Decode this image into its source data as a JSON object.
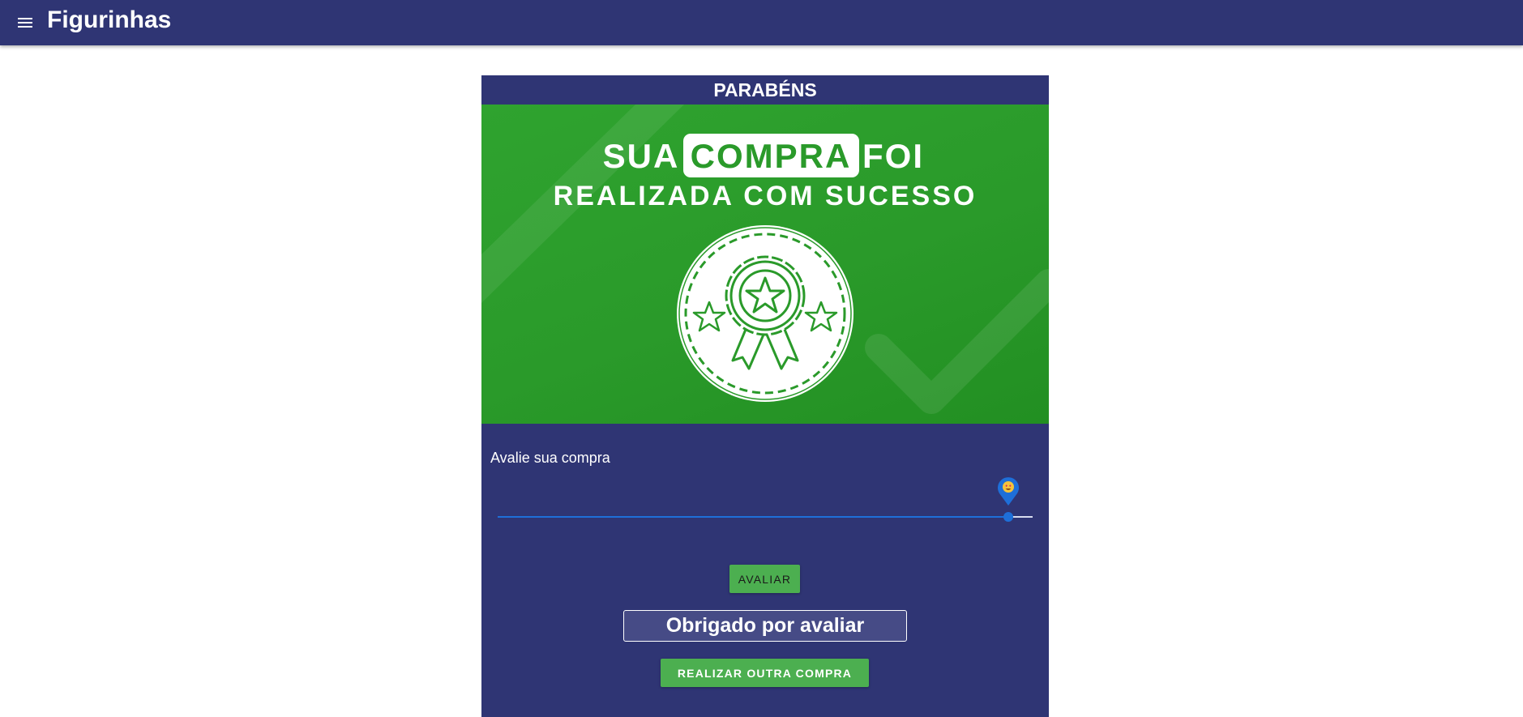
{
  "app": {
    "title": "Figurinhas",
    "menu_icon": "menu-icon"
  },
  "colors": {
    "primary": "#2f3574",
    "success_green": "#4caf50",
    "banner_green": "#2a9a2a",
    "slider_blue": "#1e6fd9"
  },
  "card": {
    "header": "PARABÉNS",
    "banner": {
      "line1_word1": "SUA",
      "line1_highlight": "COMPRA",
      "line1_word3": "FOI",
      "line2": "REALIZADA COM SUCESSO",
      "badge_icon": "award-ribbon-icon",
      "checkmark_icon": "checkmark-icon"
    },
    "rating": {
      "label": "Avalie sua compra",
      "slider_fraction": 0.955,
      "thumb_icon": "heart-eyes-emoji-icon"
    },
    "avaliar_button": "AVALIAR",
    "thanks_message": "Obrigado por avaliar",
    "new_purchase_button": "REALIZAR OUTRA COMPRA"
  }
}
